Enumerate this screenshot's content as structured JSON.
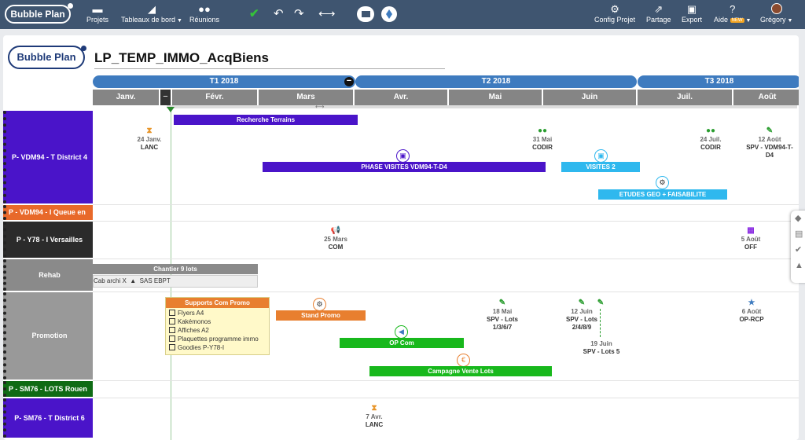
{
  "topbar": {
    "logo": "Bubble Plan",
    "nav": [
      {
        "label": "Projets",
        "icon": "folder-icon"
      },
      {
        "label": "Tableaux de bord",
        "icon": "chart-icon",
        "caret": true
      },
      {
        "label": "Réunions",
        "icon": "people-icon"
      }
    ],
    "right": [
      {
        "label": "Config Projet",
        "icon": "gear-icon"
      },
      {
        "label": "Partage",
        "icon": "share-icon"
      },
      {
        "label": "Export",
        "icon": "image-icon"
      },
      {
        "label": "Aide",
        "icon": "help-icon",
        "badge": "NEW",
        "caret": true
      },
      {
        "label": "Grégory",
        "icon": "avatar",
        "caret": true
      }
    ]
  },
  "project": {
    "logo": "Bubble Plan",
    "title": "LP_TEMP_IMMO_AcqBiens"
  },
  "timeline": {
    "quarters": [
      "T1 2018",
      "T2 2018",
      "T3 2018"
    ],
    "months": [
      "Janv.",
      "Févr.",
      "Mars",
      "Avr.",
      "Mai",
      "Juin",
      "Juil.",
      "Août"
    ],
    "collapse_label": "−"
  },
  "lanes": [
    {
      "id": "vdm94t",
      "label": "P- VDM94 - T District 4",
      "color": "#4a14c9"
    },
    {
      "id": "vdm94q",
      "label": "P - VDM94 - I Queue en",
      "color": "#e8692a"
    },
    {
      "id": "y78",
      "label": "P - Y78 - I Versailles",
      "color": "#2b2b2b"
    },
    {
      "id": "rehab",
      "label": "Rehab",
      "color": "#8a8a8a"
    },
    {
      "id": "promo",
      "label": "Promotion",
      "color": "#999999"
    },
    {
      "id": "sm76lots",
      "label": "P - SM76 - LOTS Rouen",
      "color": "#0f6b14"
    },
    {
      "id": "sm76t",
      "label": "P- SM76 - T District 6",
      "color": "#4a14c9"
    }
  ],
  "items": {
    "recherche_terrains": "Recherche Terrains",
    "phase_visites": "PHASE VISITES VDM94-T-D4",
    "visites2": "VISITES 2",
    "etudes_geo": "ETUDES GEO + FAISABILITE",
    "chantier": "Chantier 9 lots",
    "chantier_sub_a": "Cab archi X",
    "chantier_sub_b": "SAS EBPT",
    "supports_com": "Supports Com Promo",
    "supports_list": [
      "Flyers A4",
      "Kakémonos",
      "Affiches A2",
      "Plaquettes programme immo",
      "Goodies P-Y78-I"
    ],
    "stand_promo": "Stand Promo",
    "op_com": "OP Com",
    "campagne": "Campagne Vente Lots"
  },
  "milestones": {
    "lanc1": {
      "date": "24 Janv.",
      "label": "LANC"
    },
    "codir1": {
      "date": "31 Mai",
      "label": "CODIR"
    },
    "codir2": {
      "date": "24 Juil.",
      "label": "CODIR"
    },
    "spv1": {
      "date": "12 Août",
      "label": "SPV - VDM94-T-D4"
    },
    "com": {
      "date": "25 Mars",
      "label": "COM"
    },
    "off": {
      "date": "5 Août",
      "label": "OFF"
    },
    "spv_lots_a": {
      "date": "18 Mai",
      "label": "SPV - Lots 1/3/6/7"
    },
    "spv_lots_b": {
      "date": "12 Juin",
      "label": "SPV - Lots 2/4/8/9"
    },
    "spv_lots_c": {
      "date": "19 Juin",
      "label": "SPV - Lots 5"
    },
    "op_rcp": {
      "date": "6 Août",
      "label": "OP-RCP"
    },
    "lanc2": {
      "date": "7 Avr.",
      "label": "LANC"
    }
  },
  "colors": {
    "header": "#3f5570",
    "quarter": "#3e7bbf",
    "purple_bar": "#4a14c9",
    "cyan_bar": "#2fb8ee",
    "green_bar": "#18b81c",
    "orange_bar": "#e87f2f"
  }
}
